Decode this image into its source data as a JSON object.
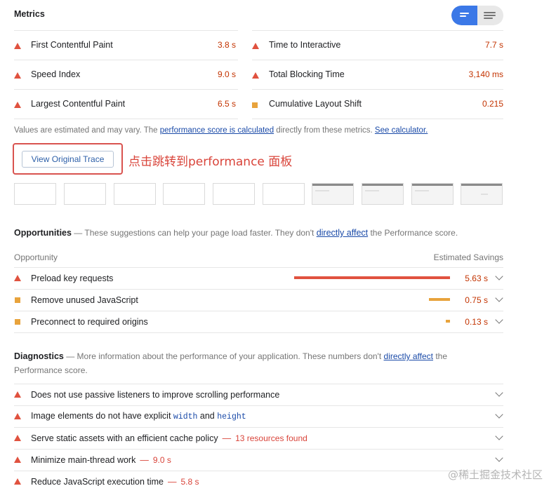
{
  "metrics": {
    "title": "Metrics",
    "left": [
      {
        "name": "First Contentful Paint",
        "value": "3.8 s",
        "status": "fail"
      },
      {
        "name": "Speed Index",
        "value": "9.0 s",
        "status": "fail"
      },
      {
        "name": "Largest Contentful Paint",
        "value": "6.5 s",
        "status": "fail"
      }
    ],
    "right": [
      {
        "name": "Time to Interactive",
        "value": "7.7 s",
        "status": "fail"
      },
      {
        "name": "Total Blocking Time",
        "value": "3,140 ms",
        "status": "fail"
      },
      {
        "name": "Cumulative Layout Shift",
        "value": "0.215",
        "status": "average"
      }
    ],
    "note_prefix": "Values are estimated and may vary. The ",
    "note_link1": "performance score is calculated",
    "note_middle": " directly from these metrics. ",
    "note_link2": "See calculator."
  },
  "trace": {
    "button_label": "View Original Trace",
    "annotation": "点击跳转到performance 面板"
  },
  "opportunities": {
    "title": "Opportunities",
    "desc_prefix": "These suggestions can help your page load faster. They don't ",
    "desc_link": "directly affect",
    "desc_suffix": " the Performance score.",
    "col_left": "Opportunity",
    "col_right": "Estimated Savings",
    "items": [
      {
        "name": "Preload key requests",
        "value": "5.63 s",
        "status": "fail",
        "fraction": 1.0
      },
      {
        "name": "Remove unused JavaScript",
        "value": "0.75 s",
        "status": "average",
        "fraction": 0.133
      },
      {
        "name": "Preconnect to required origins",
        "value": "0.13 s",
        "status": "average",
        "fraction": 0.023
      }
    ]
  },
  "diagnostics": {
    "title": "Diagnostics",
    "desc_prefix": "More information about the performance of your application. These numbers don't ",
    "desc_link": "directly affect",
    "desc_suffix": " the Performance score.",
    "items": [
      {
        "name": "Does not use passive listeners to improve scrolling performance",
        "extra": ""
      },
      {
        "name_pre": "Image elements do not have explicit ",
        "code1": "width",
        "and": " and ",
        "code2": "height"
      },
      {
        "name": "Serve static assets with an efficient cache policy",
        "extra": "13 resources found"
      },
      {
        "name": "Minimize main-thread work",
        "extra": "9.0 s"
      },
      {
        "name": "Reduce JavaScript execution time",
        "extra": "5.8 s"
      }
    ]
  },
  "watermark": "@稀土掘金技术社区",
  "colors": {
    "fail": "#e0523f",
    "average": "#e8a33c",
    "link": "#1a4aa8",
    "accent": "#3b78e7"
  }
}
